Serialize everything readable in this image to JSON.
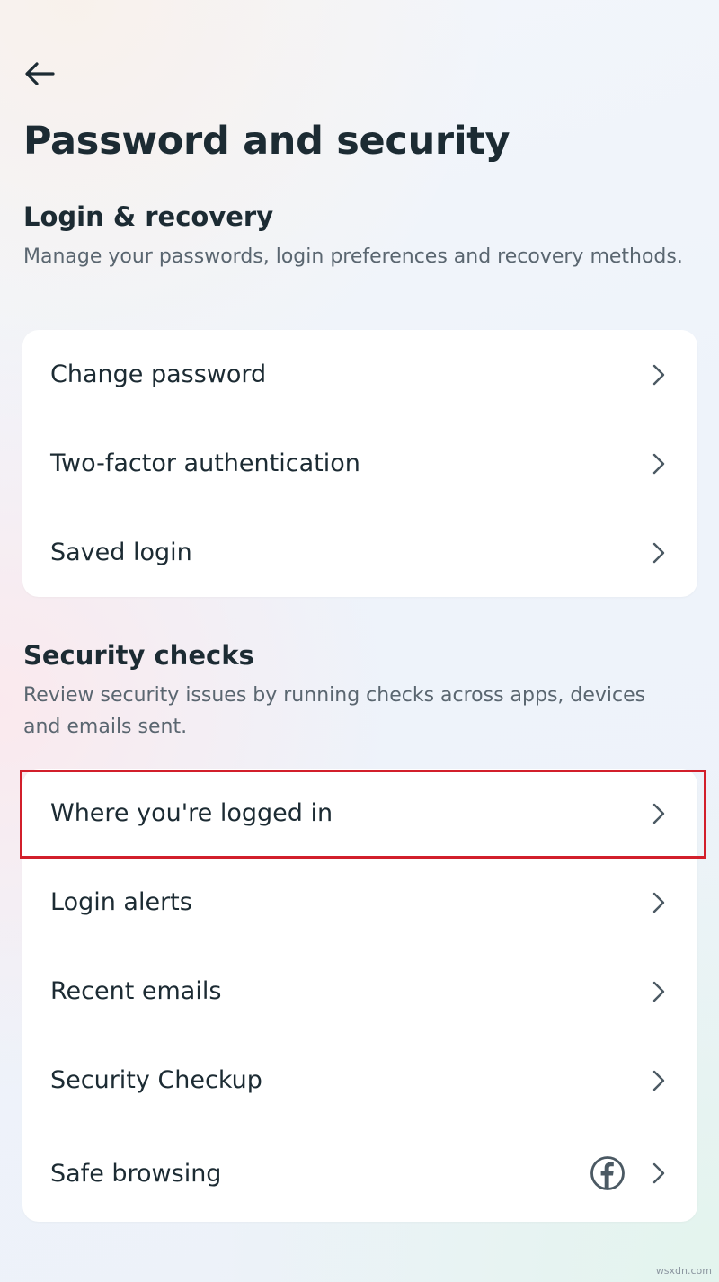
{
  "header": {
    "back_icon": "arrow-left-icon",
    "title": "Password and security"
  },
  "login_recovery": {
    "heading": "Login & recovery",
    "description": "Manage your passwords, login preferences and recovery methods.",
    "items": [
      {
        "label": "Change password",
        "icon": "chevron-right-icon"
      },
      {
        "label": "Two-factor authentication",
        "icon": "chevron-right-icon"
      },
      {
        "label": "Saved login",
        "icon": "chevron-right-icon"
      }
    ]
  },
  "security_checks": {
    "heading": "Security checks",
    "description": "Review security issues by running checks across apps, devices and emails sent.",
    "items": [
      {
        "label": "Where you're logged in",
        "icon": "chevron-right-icon",
        "highlighted": true
      },
      {
        "label": "Login alerts",
        "icon": "chevron-right-icon"
      },
      {
        "label": "Recent emails",
        "icon": "chevron-right-icon"
      },
      {
        "label": "Security Checkup",
        "icon": "chevron-right-icon"
      },
      {
        "label": "Safe browsing",
        "icon": "chevron-right-icon",
        "badge_icon": "facebook-icon"
      }
    ]
  },
  "annotation": {
    "highlight_color": "#d21f2b"
  },
  "watermark": "wsxdn.com",
  "colors": {
    "text_primary": "#1c2b33",
    "text_secondary": "#5a6670",
    "card_background": "#ffffff",
    "chevron": "#4b5963"
  }
}
